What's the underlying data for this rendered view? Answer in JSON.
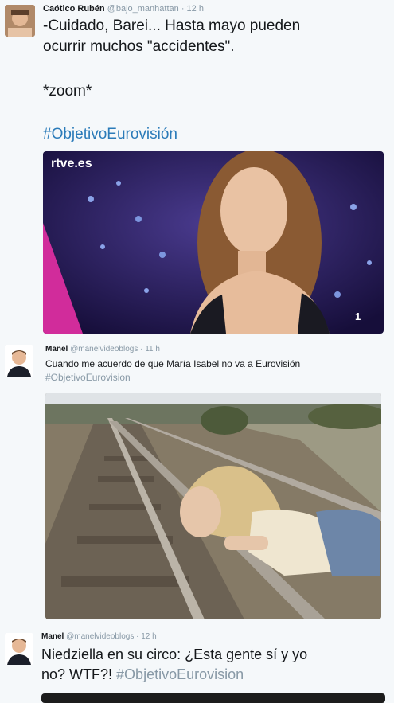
{
  "tweets": [
    {
      "name": "Caótico Rubén",
      "handle": "@bajo_manhattan",
      "time": "· 12 h",
      "line1": "-Cuidado, Barei... Hasta mayo pueden",
      "line2": "ocurrir muchos \"accidentes\".",
      "line3": "*zoom*",
      "hashtag": "#ObjetivoEurovisión",
      "media": {
        "logo": "rtve.es",
        "channel": "1"
      }
    },
    {
      "name": "Manel",
      "handle": "@manelvideoblogs",
      "time": "· 11 h",
      "line1": "Cuando me acuerdo de que María Isabel no va a Eurovisión",
      "hashtag": "#ObjetivoEurovision"
    },
    {
      "name": "Manel",
      "handle": "@manelvideoblogs",
      "time": "· 12 h",
      "line1": "Niedziella en su circo: ¿Esta gente sí y yo",
      "line2": "no? WTF?!",
      "hashtag": "#ObjetivoEurovision"
    }
  ],
  "colors": {
    "hashtag": "#2b7bb9",
    "meta": "#8899a6",
    "text": "#14171a"
  }
}
